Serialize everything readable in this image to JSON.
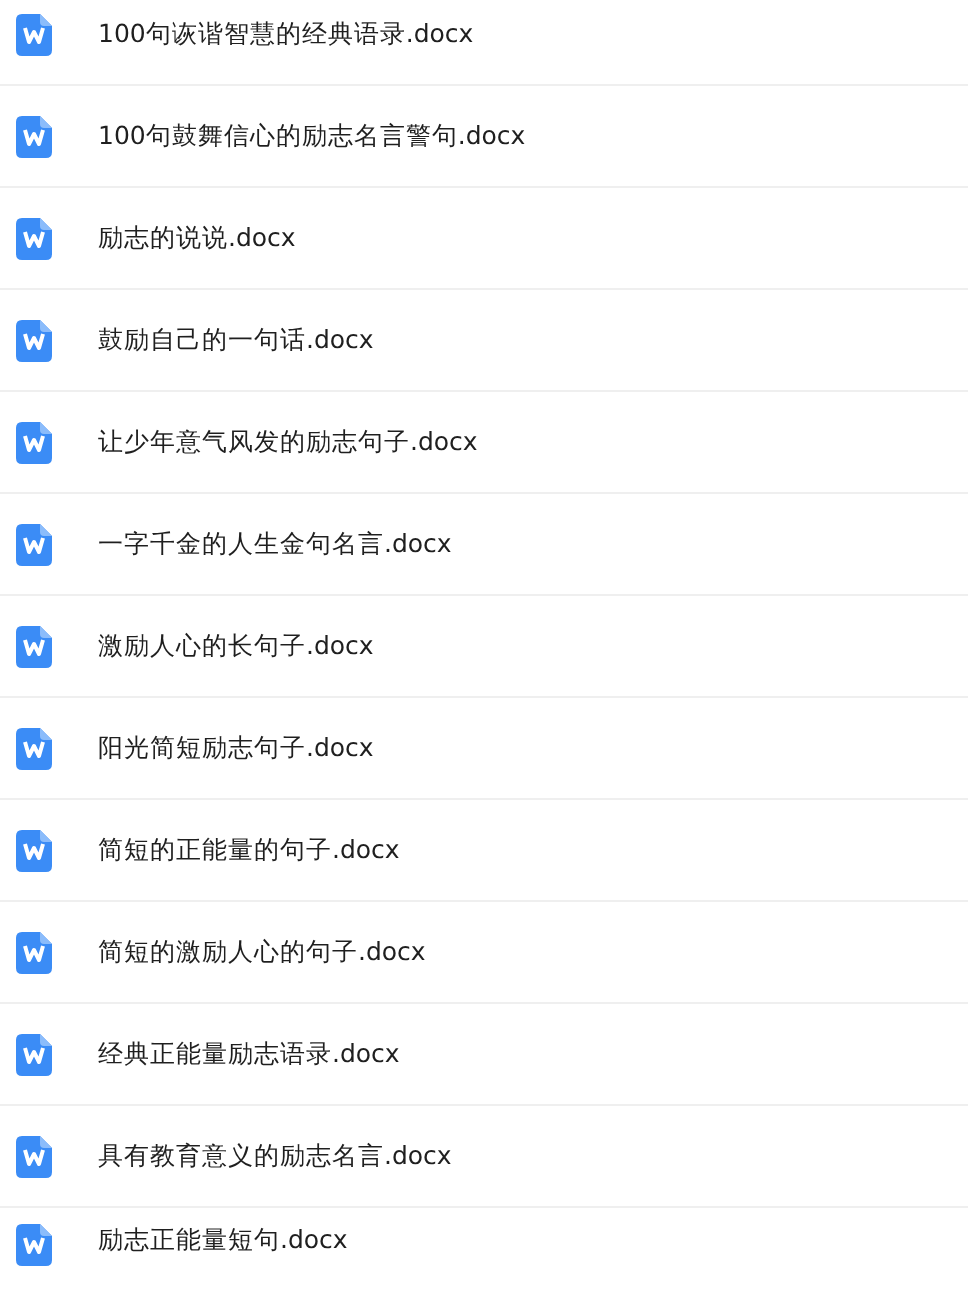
{
  "files": [
    {
      "name": "100句诙谐智慧的经典语录.docx"
    },
    {
      "name": "100句鼓舞信心的励志名言警句.docx"
    },
    {
      "name": "励志的说说.docx"
    },
    {
      "name": "鼓励自己的一句话.docx"
    },
    {
      "name": "让少年意气风发的励志句子.docx"
    },
    {
      "name": "一字千金的人生金句名言.docx"
    },
    {
      "name": "激励人心的长句子.docx"
    },
    {
      "name": "阳光简短励志句子.docx"
    },
    {
      "name": "简短的正能量的句子.docx"
    },
    {
      "name": "简短的激励人心的句子.docx"
    },
    {
      "name": "经典正能量励志语录.docx"
    },
    {
      "name": "具有教育意义的励志名言.docx"
    },
    {
      "name": "励志正能量短句.docx"
    }
  ]
}
